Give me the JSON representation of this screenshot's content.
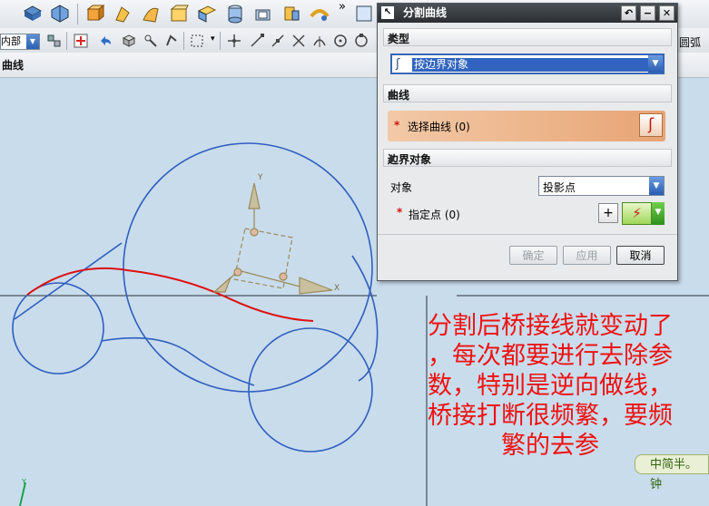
{
  "toolbar": {
    "combo_value": "内部",
    "subtitle": "曲线",
    "overflow_glyph": "»",
    "right_label": "圆弧"
  },
  "dialog": {
    "title": "分割曲线",
    "type_section": "类型",
    "type_value": "按边界对象",
    "curve_section": "曲线",
    "select_curve_label": "选择曲线 (0)",
    "boundary_section": "边界对象",
    "object_label": "对象",
    "object_value": "投影点",
    "point_label": "指定点 (0)",
    "required_marker": "*",
    "ok_label": "确定",
    "apply_label": "应用",
    "cancel_label": "取消",
    "reset_glyph": "↶",
    "min_glyph": "−",
    "close_glyph": "✕"
  },
  "viewport": {
    "axis_y": "Y",
    "axis_x": "X",
    "axis_y_small": "Y"
  },
  "annotation": {
    "lines": [
      "分割后桥接线就变动了",
      "，每次都要进行去除参",
      "数，特别是逆向做线，",
      "桥接打断很频繁，要频",
      "繁的去参"
    ]
  },
  "watermark": {
    "text": "中简半。钟"
  },
  "colors": {
    "curve_blue": "#2f5fbf",
    "curve_red": "#dd1111",
    "note_red": "#ee1111",
    "viewport_bg": "#c9dcec"
  }
}
